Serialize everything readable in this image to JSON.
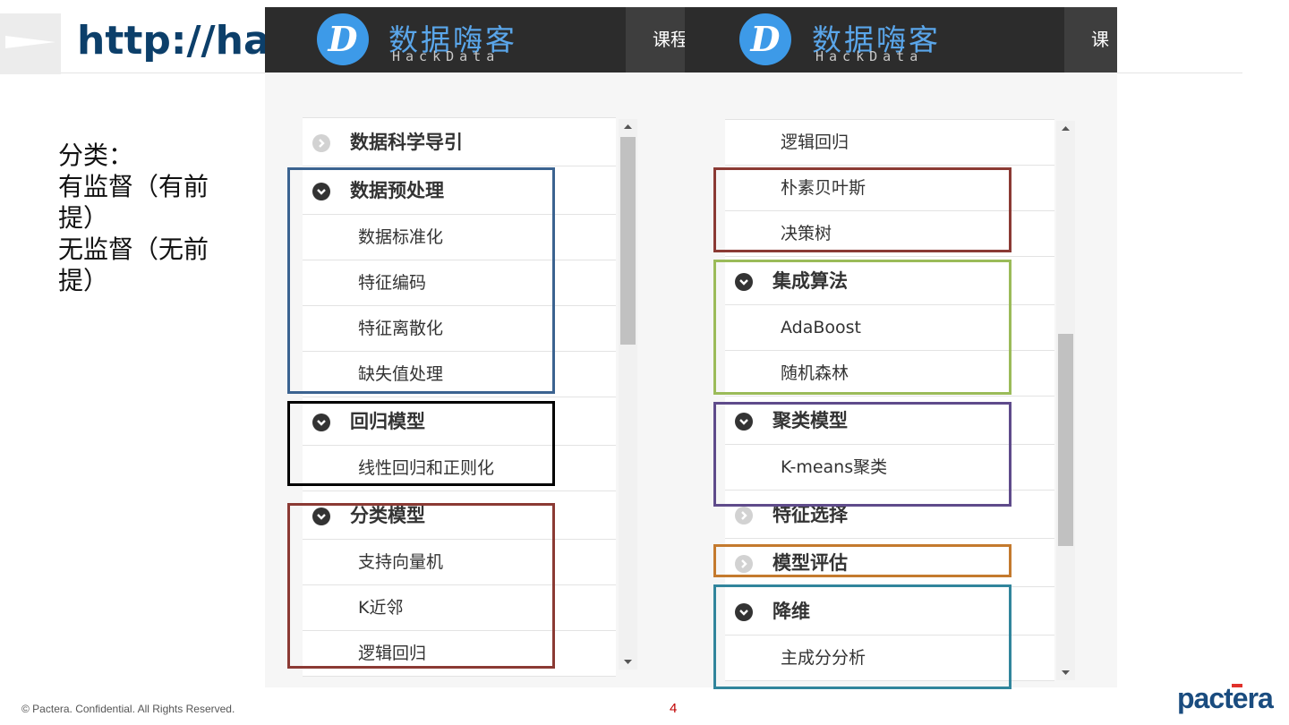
{
  "slide": {
    "title": "http://ha",
    "notes": [
      "分类：",
      "有监督（有前提）",
      "无监督（无前提）"
    ],
    "footer_copyright": "© Pactera. Confidential. All Rights Reserved.",
    "page_number": "4",
    "brand": "pactera"
  },
  "site": {
    "logo_cn": "数据嗨客",
    "logo_en": "HackData",
    "logo_letter": "D",
    "nav_tab_left": "课程",
    "nav_tab_right": "课"
  },
  "left_menu": [
    {
      "label": "数据科学导引",
      "type": "category",
      "expanded": false
    },
    {
      "label": "数据预处理",
      "type": "category",
      "expanded": true
    },
    {
      "label": "数据标准化",
      "type": "item"
    },
    {
      "label": "特征编码",
      "type": "item"
    },
    {
      "label": "特征离散化",
      "type": "item"
    },
    {
      "label": "缺失值处理",
      "type": "item"
    },
    {
      "label": "回归模型",
      "type": "category",
      "expanded": true
    },
    {
      "label": "线性回归和正则化",
      "type": "item"
    },
    {
      "label": "分类模型",
      "type": "category",
      "expanded": true
    },
    {
      "label": "支持向量机",
      "type": "item"
    },
    {
      "label": "K近邻",
      "type": "item"
    },
    {
      "label": "逻辑回归",
      "type": "item"
    }
  ],
  "right_menu": [
    {
      "label": "逻辑回归",
      "type": "item"
    },
    {
      "label": "朴素贝叶斯",
      "type": "item"
    },
    {
      "label": "决策树",
      "type": "item"
    },
    {
      "label": "集成算法",
      "type": "category",
      "expanded": true
    },
    {
      "label": "AdaBoost",
      "type": "item"
    },
    {
      "label": "随机森林",
      "type": "item"
    },
    {
      "label": "聚类模型",
      "type": "category",
      "expanded": true
    },
    {
      "label": "K-means聚类",
      "type": "item"
    },
    {
      "label": "特征选择",
      "type": "category",
      "expanded": false
    },
    {
      "label": "模型评估",
      "type": "category",
      "expanded": false
    },
    {
      "label": "降维",
      "type": "category",
      "expanded": true
    },
    {
      "label": "主成分分析",
      "type": "item"
    }
  ],
  "colors": {
    "title": "#0c3f6a",
    "header_bg": "#2c2c2c",
    "logo_blue": "#3d9ae8",
    "highlight_preprocessing": "#3b6390",
    "highlight_regression": "#000000",
    "highlight_classification": "#8b3a34",
    "highlight_bayes_tree": "#8b3a34",
    "highlight_ensemble": "#9bbb59",
    "highlight_clustering": "#5f4b8b",
    "highlight_evaluation": "#c47a2e",
    "highlight_dimensionality": "#31859c",
    "page_number": "#c00000",
    "brand": "#1a4c7f"
  },
  "icons": {
    "expanded": "chevron-down-icon",
    "collapsed": "chevron-right-icon",
    "slide_marker": "triangle-icon"
  }
}
